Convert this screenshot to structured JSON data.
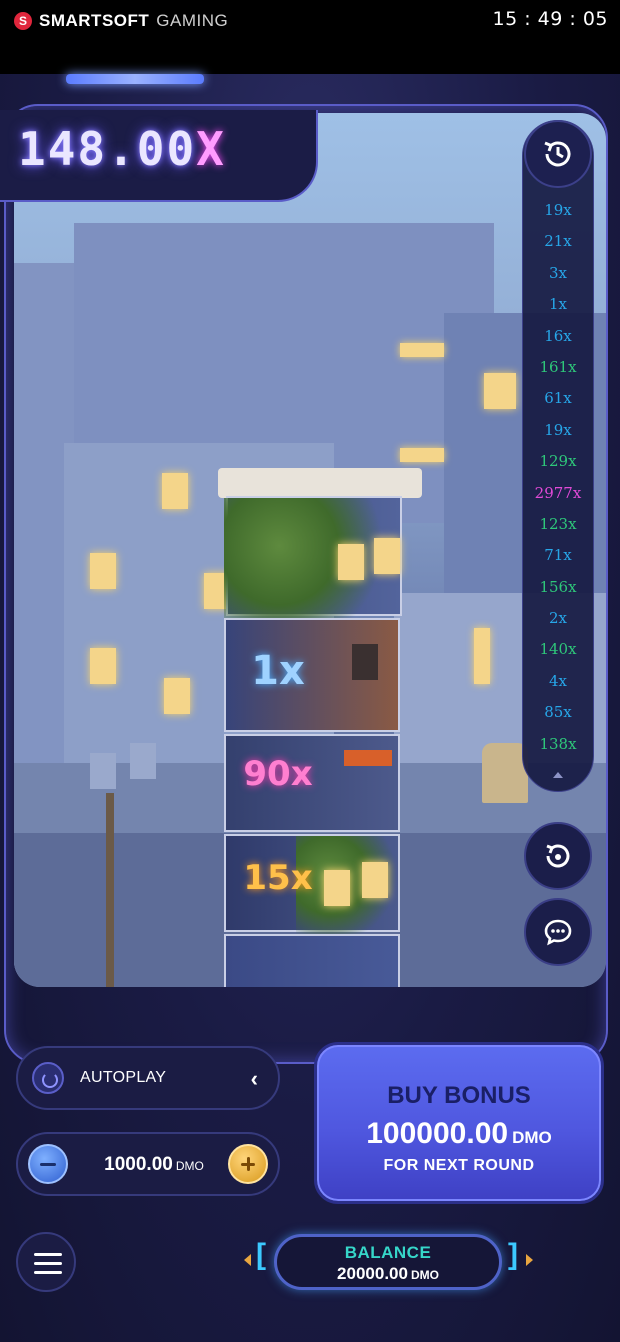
{
  "topbar": {
    "brand_name": "SMARTSOFT",
    "brand_sub": "GAMING",
    "clock": "15 : 49 : 05"
  },
  "game": {
    "multiplier_value": "148.00",
    "multiplier_suffix": "X",
    "tower_floors": [
      "1x",
      "90x",
      "15x"
    ]
  },
  "history": {
    "items": [
      {
        "value": "19x",
        "color": "#27a6e8"
      },
      {
        "value": "21x",
        "color": "#27a6e8"
      },
      {
        "value": "3x",
        "color": "#27a6e8"
      },
      {
        "value": "1x",
        "color": "#27a6e8"
      },
      {
        "value": "16x",
        "color": "#27a6e8"
      },
      {
        "value": "161x",
        "color": "#2ec77a"
      },
      {
        "value": "61x",
        "color": "#27a6e8"
      },
      {
        "value": "19x",
        "color": "#27a6e8"
      },
      {
        "value": "129x",
        "color": "#2ec77a"
      },
      {
        "value": "2977x",
        "color": "#e24ad8"
      },
      {
        "value": "123x",
        "color": "#2ec77a"
      },
      {
        "value": "71x",
        "color": "#27a6e8"
      },
      {
        "value": "156x",
        "color": "#2ec77a"
      },
      {
        "value": "2x",
        "color": "#27a6e8"
      },
      {
        "value": "140x",
        "color": "#2ec77a"
      },
      {
        "value": "4x",
        "color": "#27a6e8"
      },
      {
        "value": "85x",
        "color": "#27a6e8"
      },
      {
        "value": "138x",
        "color": "#2ec77a"
      }
    ]
  },
  "controls": {
    "autoplay_label": "AUTOPLAY",
    "bet_value": "1000.00",
    "currency": "DMO",
    "buy_bonus_title": "BUY BONUS",
    "buy_bonus_amount": "100000.00",
    "buy_bonus_sub": "FOR NEXT ROUND",
    "balance_label": "BALANCE",
    "balance_value": "20000.00"
  }
}
